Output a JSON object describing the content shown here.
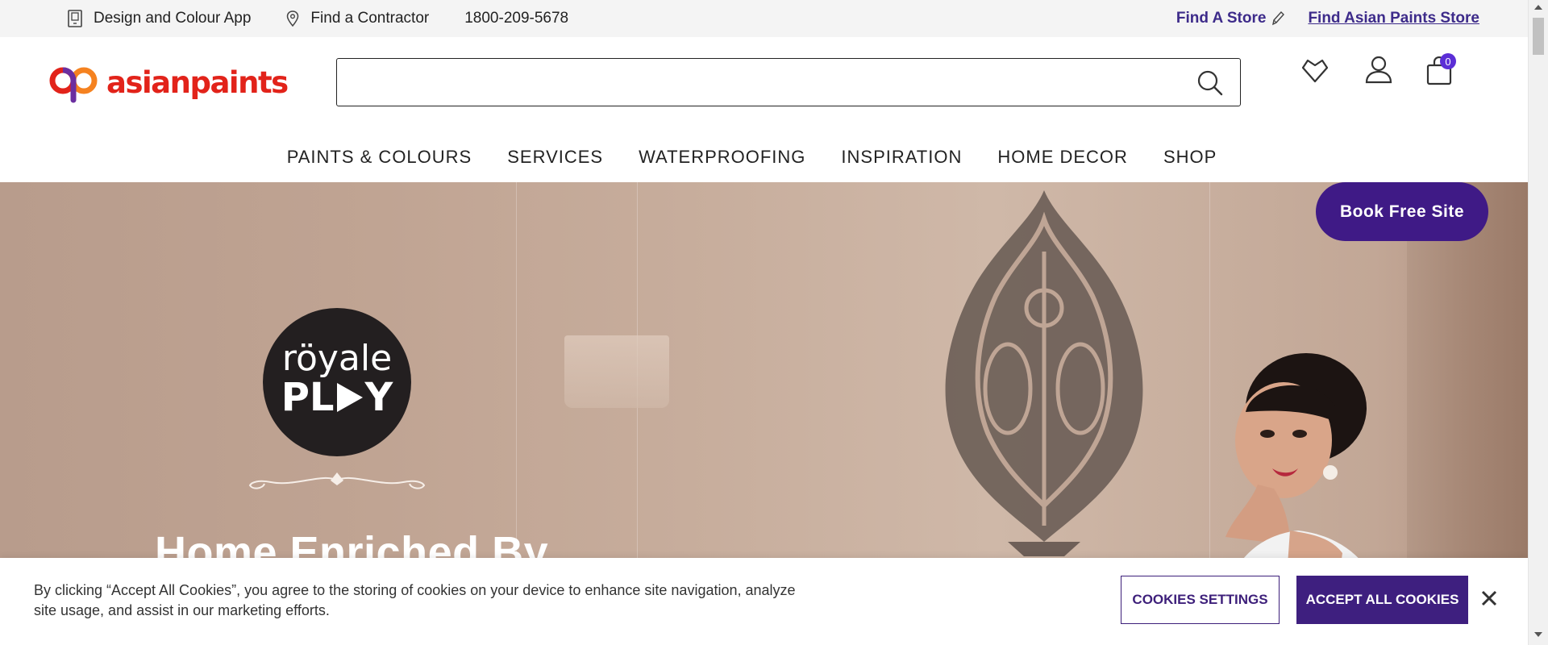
{
  "utility_bar": {
    "design_app": "Design and Colour App",
    "find_contractor": "Find a Contractor",
    "phone": "1800-209-5678",
    "find_store": "Find A Store",
    "find_ap_store": "Find Asian Paints Store"
  },
  "header": {
    "logo_text": "asianpaints",
    "search_placeholder": "",
    "cart_count": "0"
  },
  "nav": {
    "items": [
      "PAINTS & COLOURS",
      "SERVICES",
      "WATERPROOFING",
      "INSPIRATION",
      "HOME DECOR",
      "SHOP"
    ]
  },
  "hero": {
    "brand_top": "röyale",
    "brand_bottom_left": "PL",
    "brand_bottom_right": "Y",
    "heading": "Home Enriched By",
    "book_button": "Book Free Site"
  },
  "cookie_banner": {
    "text": "By clicking “Accept All Cookies”, you agree to the storing of cookies on your device to enhance site navigation, analyze site usage, and assist in our marketing efforts.",
    "settings_button": "COOKIES SETTINGS",
    "accept_button": "ACCEPT ALL COOKIES"
  },
  "colors": {
    "brand_purple": "#3f1a86",
    "brand_red": "#e2231a",
    "badge_purple": "#5b2ed6"
  },
  "icons": [
    "mobile-app-icon",
    "location-pin-icon",
    "pencil-icon",
    "search-icon",
    "wishlist-heart-icon",
    "user-profile-icon",
    "cart-bag-icon",
    "close-icon"
  ]
}
